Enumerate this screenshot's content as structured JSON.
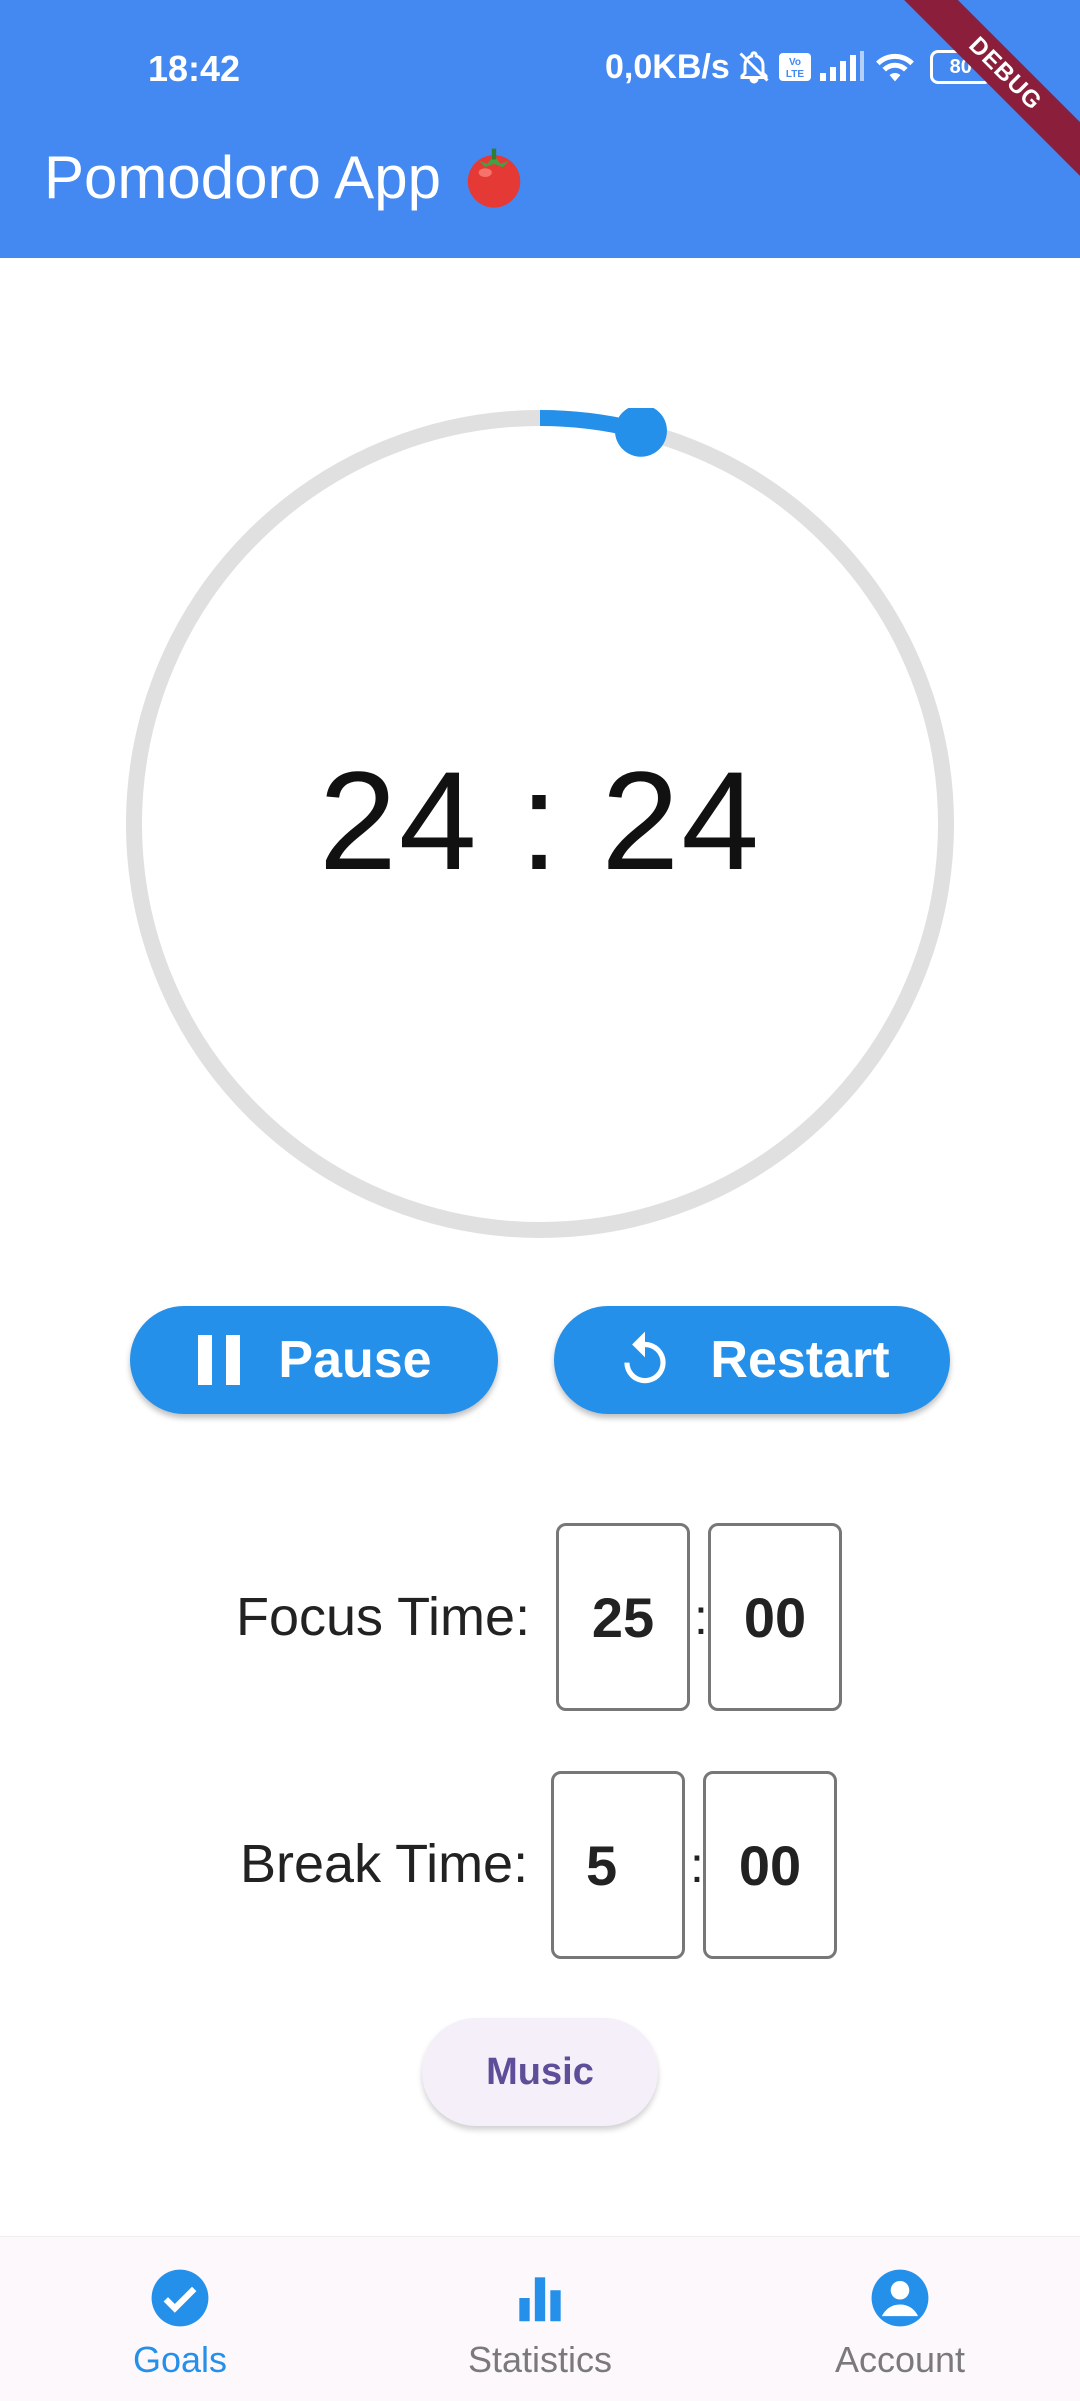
{
  "status_bar": {
    "time": "18:42",
    "network_speed": "0,0KB/s",
    "battery": "80",
    "icons": [
      "bell-off-icon",
      "volte-icon",
      "signal-icon",
      "wifi-icon",
      "battery-icon"
    ]
  },
  "debug_banner": "DEBUG",
  "app_bar": {
    "title": "Pomodoro App",
    "emoji_icon": "tomato-icon"
  },
  "timer": {
    "display": "24 : 24",
    "progress_fraction": 0.04
  },
  "controls": {
    "pause": {
      "label": "Pause",
      "icon": "pause-icon"
    },
    "restart": {
      "label": "Restart",
      "icon": "restart-icon"
    }
  },
  "settings": {
    "focus": {
      "label": "Focus Time:",
      "minutes": "25",
      "separator": ":",
      "seconds": "00"
    },
    "break": {
      "label": "Break Time:",
      "minutes": "5",
      "separator": ":",
      "seconds": "00"
    }
  },
  "music_button": {
    "label": "Music"
  },
  "bottom_nav": {
    "items": [
      {
        "label": "Goals",
        "icon": "check-circle-icon",
        "active": true
      },
      {
        "label": "Statistics",
        "icon": "bar-chart-icon",
        "active": false
      },
      {
        "label": "Account",
        "icon": "account-circle-icon",
        "active": false
      }
    ]
  },
  "colors": {
    "app_bar": "#4489f1",
    "accent": "#2490ea",
    "ring_track": "#e0e0e0",
    "music_text": "#5e4d98",
    "nav_inactive": "#7a7a7a"
  }
}
